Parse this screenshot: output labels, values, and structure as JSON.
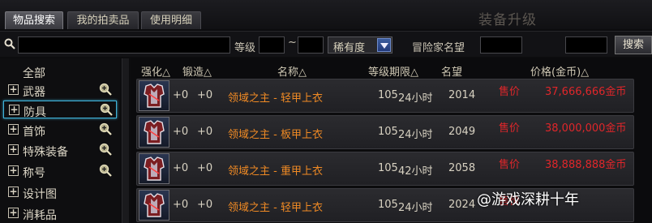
{
  "tabs": [
    {
      "label": "物品搜索",
      "active": true
    },
    {
      "label": "我的拍卖品",
      "active": false
    },
    {
      "label": "使用明细",
      "active": false
    }
  ],
  "header_deco": "装备升级",
  "filters": {
    "level_label": "等级",
    "level_sep": "~",
    "rarity_value": "稀有度",
    "adventurer_label": "冒险家名望",
    "search_button": "搜索"
  },
  "sidebar": {
    "all_label": "全部",
    "items": [
      {
        "label": "武器",
        "selected": false
      },
      {
        "label": "防具",
        "selected": true
      },
      {
        "label": "首饰",
        "selected": false
      },
      {
        "label": "特殊装备",
        "selected": false
      },
      {
        "label": "称号",
        "selected": false
      },
      {
        "label": "设计图",
        "selected": false
      },
      {
        "label": "消耗品",
        "selected": false
      }
    ]
  },
  "columns": [
    "强化△",
    "锻造△",
    "名称△",
    "等级期限△",
    "名望",
    "价格(金币)△"
  ],
  "rows": [
    {
      "enhance": "+0",
      "forge": "+0",
      "name": "领域之主 - 轻甲上衣",
      "level": "105",
      "duration": "24小时",
      "fame": "2014",
      "sale": "售价",
      "price": "37,666,666金币"
    },
    {
      "enhance": "+0",
      "forge": "+0",
      "name": "领域之主 - 板甲上衣",
      "level": "105",
      "duration": "24小时",
      "fame": "2049",
      "sale": "售价",
      "price": "38,000,000金币"
    },
    {
      "enhance": "+0",
      "forge": "+0",
      "name": "领域之主 - 重甲上衣",
      "level": "105",
      "duration": "42小时",
      "fame": "2058",
      "sale": "售价",
      "price": "38,888,888金币"
    },
    {
      "enhance": "+0",
      "forge": "+0",
      "name": "领域之主 - 轻甲上衣",
      "level": "105",
      "duration": "24小时",
      "fame": "2024",
      "sale": "售价",
      "price": ""
    }
  ],
  "watermark": "@游戏深耕十年",
  "colors": {
    "accent_selected": "#3fb3d9",
    "item_name": "#f08a24",
    "price": "#e0262a"
  }
}
